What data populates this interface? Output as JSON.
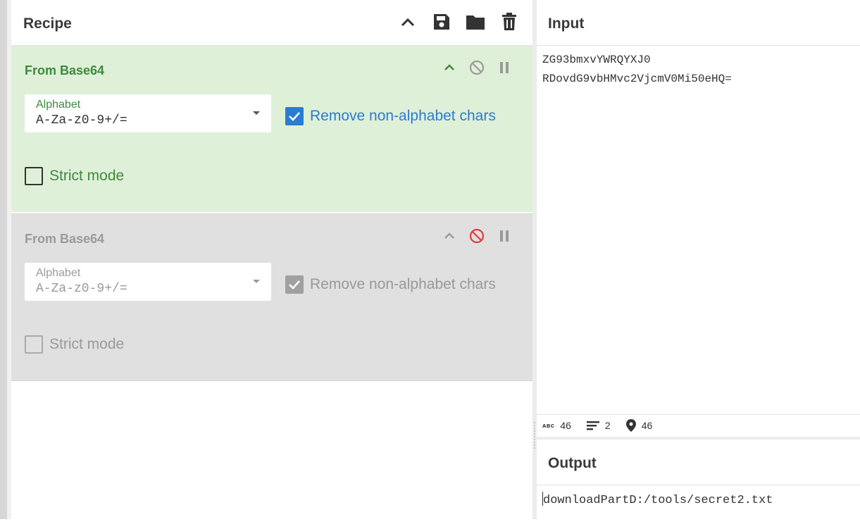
{
  "recipe": {
    "title": "Recipe",
    "icons": [
      "chevron-up-icon",
      "save-icon",
      "folder-icon",
      "trash-icon"
    ],
    "operations": [
      {
        "title": "From Base64",
        "state": "enabled",
        "alphabet_label": "Alphabet",
        "alphabet_value": "A-Za-z0-9+/=",
        "remove_label": "Remove non-alphabet chars",
        "remove_checked": true,
        "strict_label": "Strict mode",
        "strict_checked": false
      },
      {
        "title": "From Base64",
        "state": "disabled",
        "alphabet_label": "Alphabet",
        "alphabet_value": "A-Za-z0-9+/=",
        "remove_label": "Remove non-alphabet chars",
        "remove_checked": true,
        "strict_label": "Strict mode",
        "strict_checked": false
      }
    ]
  },
  "input": {
    "title": "Input",
    "lines": [
      "ZG93bmxvYWRQYXJ0",
      "RDovdG9vbHMvc2VjcmV0Mi50eHQ="
    ],
    "status": {
      "length": "46",
      "lines": "2",
      "position": "46"
    }
  },
  "output": {
    "title": "Output",
    "text": "downloadPartD:/tools/secret2.txt"
  },
  "colors": {
    "enabled_bg": "#dff0d8",
    "disabled_bg": "#e0e0e0",
    "accent_blue": "#2a7bd3",
    "green_text": "#3c8a3c",
    "disable_red": "#e03c3c"
  }
}
